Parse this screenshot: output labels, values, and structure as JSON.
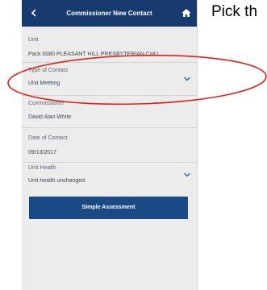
{
  "header": {
    "title": "Commissioner New Contact",
    "back_icon": "chevron-left-icon",
    "home_icon": "home-icon"
  },
  "fields": [
    {
      "label": "Unit",
      "value": "Pack 0080 PLEASANT HILL PRESBYTERIAN CHU..."
    },
    {
      "label": "Type of Contact",
      "value": "Unit Meeting",
      "dropdown": true
    },
    {
      "label": "Commissioner",
      "value": "David Alan White"
    },
    {
      "label": "Date of Contact",
      "value": "09/13/2017"
    },
    {
      "label": "Unit Health",
      "value": "Unit health unchanged",
      "dropdown": true
    }
  ],
  "actions": {
    "simple_assessment": "Simple Assessment"
  },
  "instruction": {
    "text": "Pick th"
  },
  "colors": {
    "header": "#173b6e",
    "button": "#1a4a86",
    "annotation_ellipse": "#e0201a"
  }
}
